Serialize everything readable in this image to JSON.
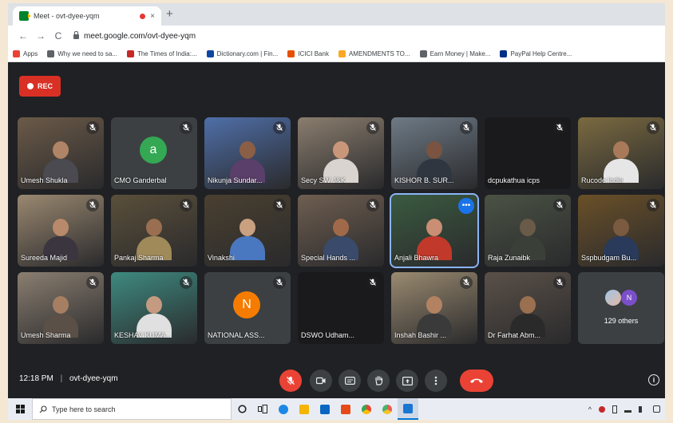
{
  "browser": {
    "tab_title": "Meet - ovt-dyee-yqm",
    "tab_close": "×",
    "new_tab": "+",
    "back": "←",
    "forward": "→",
    "reload": "C",
    "url": "meet.google.com/ovt-dyee-yqm",
    "bookmarks": [
      {
        "label": "Apps",
        "color": "#ea4335"
      },
      {
        "label": "Why we need to sa...",
        "color": "#5f6368"
      },
      {
        "label": "The Times of India:...",
        "color": "#c62828"
      },
      {
        "label": "Dictionary.com | Fin...",
        "color": "#0d47a1"
      },
      {
        "label": "ICICI Bank",
        "color": "#e65100"
      },
      {
        "label": "AMENDMENTS TO...",
        "color": "#f9a825"
      },
      {
        "label": "Earn Money | Make...",
        "color": "#5f6368"
      },
      {
        "label": "PayPal Help Centre...",
        "color": "#003087"
      }
    ]
  },
  "meet": {
    "rec_label": "REC",
    "meeting_time": "12:18 PM",
    "meeting_code": "ovt-dyee-yqm",
    "others_count_label": "129 others",
    "others_avatar_letter": "N",
    "participants": [
      {
        "name": "Umesh Shukla",
        "bg": "#6b5a48",
        "skin": "#b08466",
        "shirt": "#4a4a50"
      },
      {
        "name": "CMO Ganderbal",
        "avatar": "a",
        "avatar_color": "#34a853"
      },
      {
        "name": "Nikunja Sundar...",
        "bg": "#4f6fa8",
        "skin": "#8a5f46",
        "shirt": "#5a3f6a"
      },
      {
        "name": "Secy SW J&K",
        "bg": "#8a7d6e",
        "skin": "#c9967a",
        "shirt": "#d9d4cf"
      },
      {
        "name": "KISHOR B. SUR...",
        "bg": "#6e7a86",
        "skin": "#7a5440",
        "shirt": "#2f3640"
      },
      {
        "name": "dcpukathua icps",
        "dark": true
      },
      {
        "name": "Rucode India",
        "bg": "#7a6a40",
        "skin": "#a87a5a",
        "shirt": "#e6e6e6"
      },
      {
        "name": "Sureeda Majid",
        "bg": "#9a8870",
        "skin": "#b8896a",
        "shirt": "#3b3540"
      },
      {
        "name": "Pankaj Sharma",
        "bg": "#5a4f3a",
        "skin": "#9a6e50",
        "shirt": "#a08a5a"
      },
      {
        "name": "Vinakshi",
        "bg": "#4a4030",
        "skin": "#c9a080",
        "shirt": "#4a78c0"
      },
      {
        "name": "Special Hands ...",
        "bg": "#6e5e50",
        "skin": "#a06a4a",
        "shirt": "#3a4a6a"
      },
      {
        "name": "Anjali Bhawra",
        "bg": "#3a5a40",
        "skin": "#c98e74",
        "shirt": "#c0392b",
        "active": true
      },
      {
        "name": "Raja Zunaibk",
        "bg": "#4a5244",
        "skin": "#6a5a48",
        "shirt": "#3a4038"
      },
      {
        "name": "Sspbudgam Bu...",
        "bg": "#6a5028",
        "skin": "#7a5a40",
        "shirt": "#2a3a5a"
      },
      {
        "name": "Umesh Sharma",
        "bg": "#8a7e70",
        "skin": "#a67e62",
        "shirt": "#5a5048"
      },
      {
        "name": "KESHAV KUMA...",
        "bg": "#3e8a80",
        "skin": "#c49a80",
        "shirt": "#e0e0e0"
      },
      {
        "name": "NATIONAL ASS...",
        "avatar": "N",
        "avatar_color": "#f57c00"
      },
      {
        "name": "DSWO Udham...",
        "dark": true
      },
      {
        "name": "Inshah Bashir ...",
        "bg": "#9a8a70",
        "skin": "#b28262",
        "shirt": "#3a3a3a"
      },
      {
        "name": "Dr Farhat Abm...",
        "bg": "#5a5048",
        "skin": "#9a7050",
        "shirt": "#2a2a2a"
      }
    ]
  },
  "taskbar": {
    "search_placeholder": "Type here to search"
  }
}
